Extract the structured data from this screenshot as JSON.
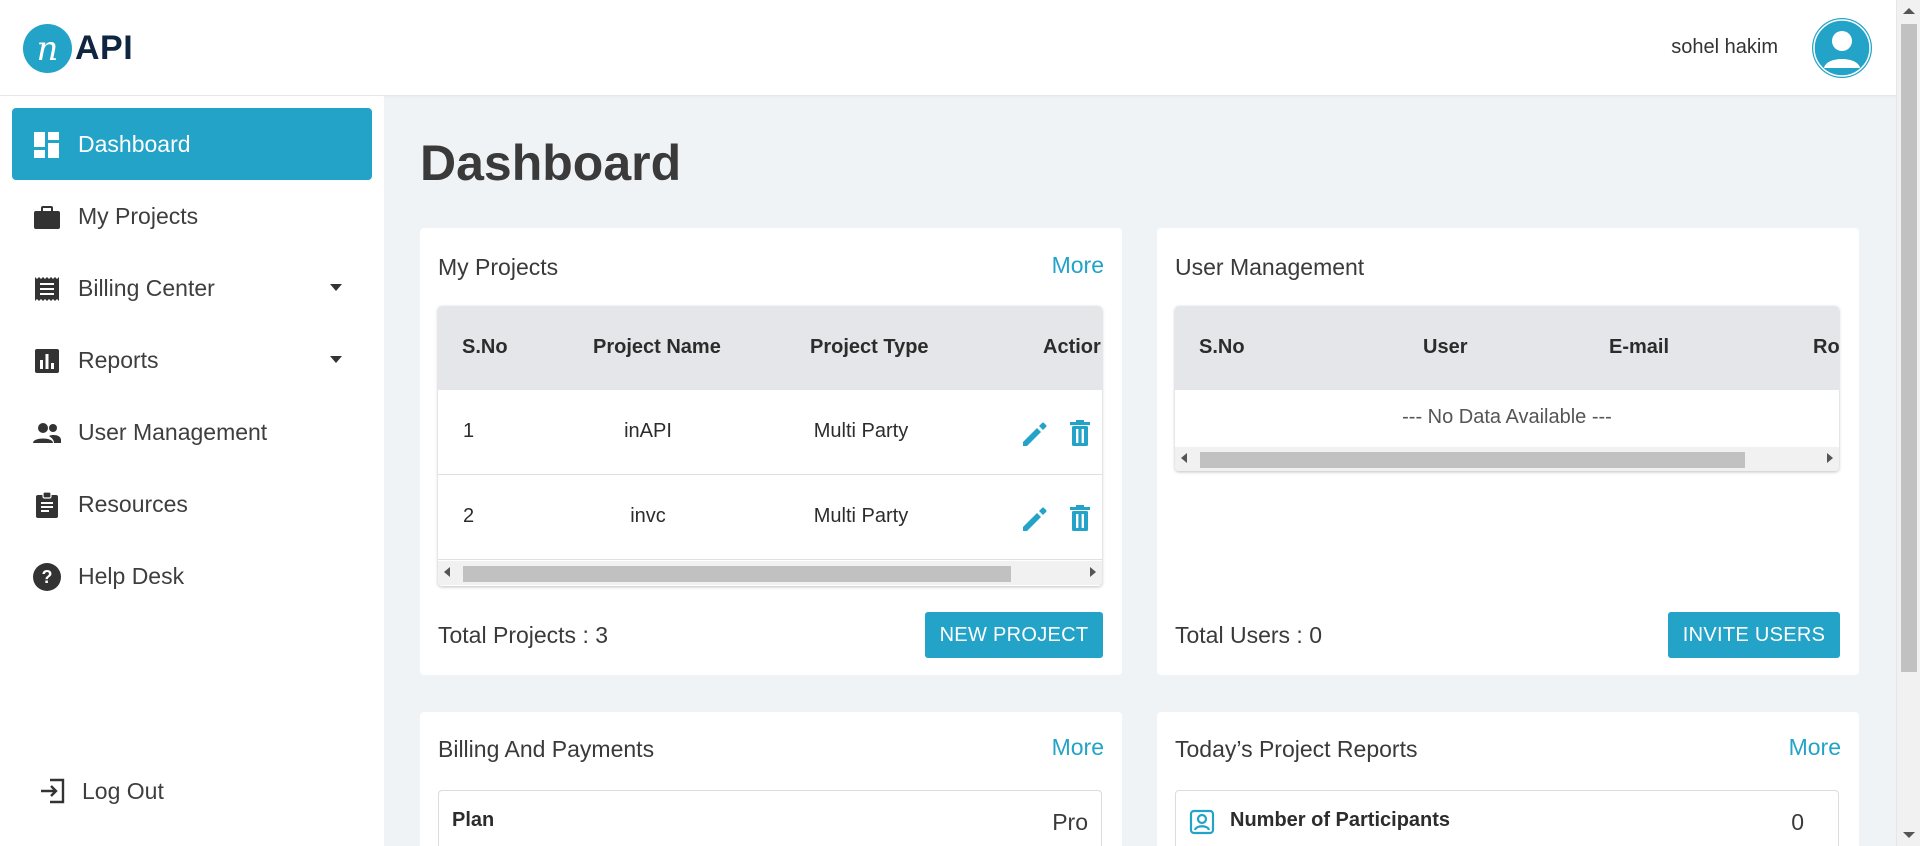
{
  "header": {
    "logo_mark": "n",
    "logo_text": "API",
    "user_name": "sohel hakim"
  },
  "sidebar": {
    "items": [
      {
        "label": "Dashboard",
        "icon": "dashboard-icon",
        "active": true
      },
      {
        "label": "My Projects",
        "icon": "briefcase-icon"
      },
      {
        "label": "Billing Center",
        "icon": "receipt-icon",
        "has_dropdown": true
      },
      {
        "label": "Reports",
        "icon": "bar-chart-icon",
        "has_dropdown": true
      },
      {
        "label": "User Management",
        "icon": "people-icon"
      },
      {
        "label": "Resources",
        "icon": "clipboard-icon"
      },
      {
        "label": "Help Desk",
        "icon": "help-icon"
      }
    ],
    "logout_label": "Log Out"
  },
  "main": {
    "title": "Dashboard",
    "projects_card": {
      "title": "My Projects",
      "more": "More",
      "columns": [
        "S.No",
        "Project Name",
        "Project Type",
        "Actior"
      ],
      "rows": [
        {
          "sno": "1",
          "name": "inAPI",
          "type": "Multi Party"
        },
        {
          "sno": "2",
          "name": "invc",
          "type": "Multi Party"
        }
      ],
      "total_label": "Total Projects : 3",
      "button": "NEW PROJECT"
    },
    "users_card": {
      "title": "User Management",
      "columns": [
        "S.No",
        "User",
        "E-mail",
        "Ro"
      ],
      "empty_text": "--- No Data Available ---",
      "total_label": "Total Users : 0",
      "button": "INVITE USERS"
    },
    "billing_card": {
      "title": "Billing And Payments",
      "more": "More",
      "plan_label": "Plan",
      "plan_value": "Pro"
    },
    "reports_card": {
      "title": "Today’s Project Reports",
      "more": "More",
      "metric_label": "Number of Participants",
      "metric_value": "0"
    }
  },
  "colors": {
    "accent": "#23a3c7",
    "background": "#f0f3f6",
    "table_header": "#e4e6ea"
  }
}
